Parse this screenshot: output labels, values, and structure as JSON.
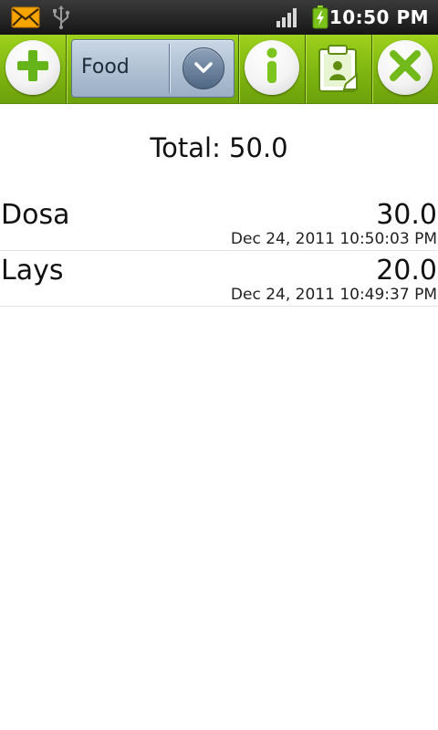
{
  "status_bar": {
    "time": "10:50 PM",
    "icons": [
      "mail-icon",
      "usb-icon",
      "signal-icon",
      "battery-charging-icon"
    ]
  },
  "toolbar": {
    "add_icon": "plus-icon",
    "category_selected": "Food",
    "info_icon": "info-icon",
    "clipboard_icon": "clipboard-icon",
    "close_icon": "close-icon",
    "accent_color": "#7fb511"
  },
  "summary": {
    "total_text": "Total: 50.0"
  },
  "expenses": [
    {
      "name": "Dosa",
      "amount": "30.0",
      "date": "Dec 24, 2011 10:50:03 PM"
    },
    {
      "name": "Lays",
      "amount": "20.0",
      "date": "Dec 24, 2011 10:49:37 PM"
    }
  ]
}
